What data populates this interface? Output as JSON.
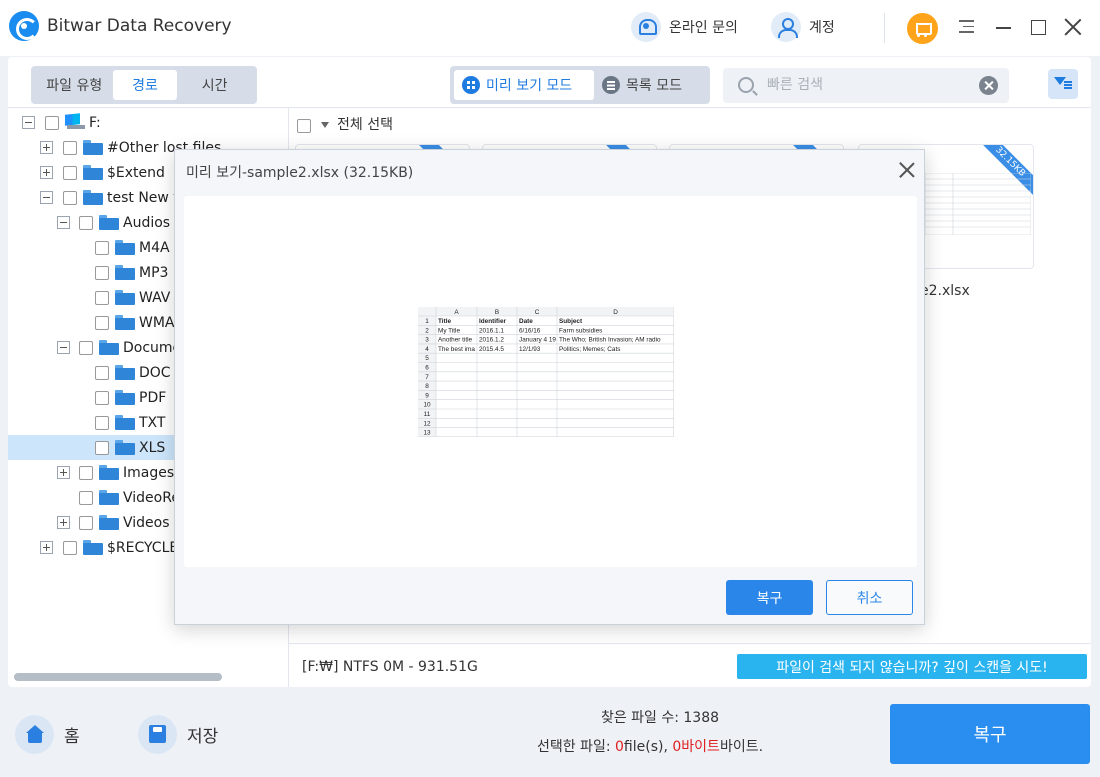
{
  "app": {
    "title": "Bitwar Data Recovery"
  },
  "titlebar": {
    "support_label": "온라인 문의",
    "account_label": "계정"
  },
  "tabs": {
    "file_type": "파일 유형",
    "path": "경로",
    "time": "시간"
  },
  "modes": {
    "preview": "미리 보기 모드",
    "list": "목록 모드"
  },
  "search": {
    "placeholder": "빠른 검색"
  },
  "tree": {
    "items": [
      {
        "label": "F:"
      },
      {
        "label": "#Other lost files"
      },
      {
        "label": "$Extend"
      },
      {
        "label": "test New f"
      },
      {
        "label": "Audios"
      },
      {
        "label": "M4A"
      },
      {
        "label": "MP3"
      },
      {
        "label": "WAV"
      },
      {
        "label": "WMA"
      },
      {
        "label": "Docume"
      },
      {
        "label": "DOC"
      },
      {
        "label": "PDF"
      },
      {
        "label": "TXT"
      },
      {
        "label": "XLS"
      },
      {
        "label": "Images"
      },
      {
        "label": "VideoRe"
      },
      {
        "label": "Videos"
      },
      {
        "label": "$RECYCLE"
      }
    ]
  },
  "files": {
    "select_all": "전체 선택",
    "visible_name": "e2.xlsx",
    "ribbon_size": "32.15KB"
  },
  "status": {
    "drive_info": "[F:₩] NTFS 0M - 931.51G",
    "deep_scan": "파일이 검색 되지 않습니까? 깊이 스캔을 시도!"
  },
  "dialog": {
    "title": "미리 보기-sample2.xlsx (32.15KB)",
    "recover_label": "복구",
    "cancel_label": "취소"
  },
  "sheet": {
    "columns": [
      "A",
      "B",
      "C",
      "D"
    ],
    "rows": [
      [
        "Title",
        "Identifier",
        "Date",
        "Subject"
      ],
      [
        "My Title",
        "2016.1.1",
        "6/16/16",
        "Farm subsidies"
      ],
      [
        "Another title",
        "2016.1.2",
        "January 4 19",
        "The Who; British Invasion; AM radio"
      ],
      [
        "The best ima",
        "2015.4.5",
        "12/1/93",
        "Politics; Memes; Cats"
      ]
    ],
    "row_numbers": [
      "1",
      "2",
      "3",
      "4",
      "5",
      "6",
      "7",
      "8",
      "9",
      "10",
      "11",
      "12",
      "13"
    ]
  },
  "bottom": {
    "home_label": "홈",
    "save_label": "저장",
    "found_files": "찾은 파일 수: 1388",
    "selected_prefix": "선택한 파일: ",
    "selected_count": "0",
    "selected_files_unit": "file(s), ",
    "selected_bytes_value": "0바이트",
    "selected_bytes_unit": "바이트.",
    "recover_label": "복구"
  },
  "colors": {
    "accent": "#2a86e9",
    "deep_scan": "#2ab4ef",
    "cart": "#ffa31a",
    "selected_row": "#cde5fb"
  }
}
